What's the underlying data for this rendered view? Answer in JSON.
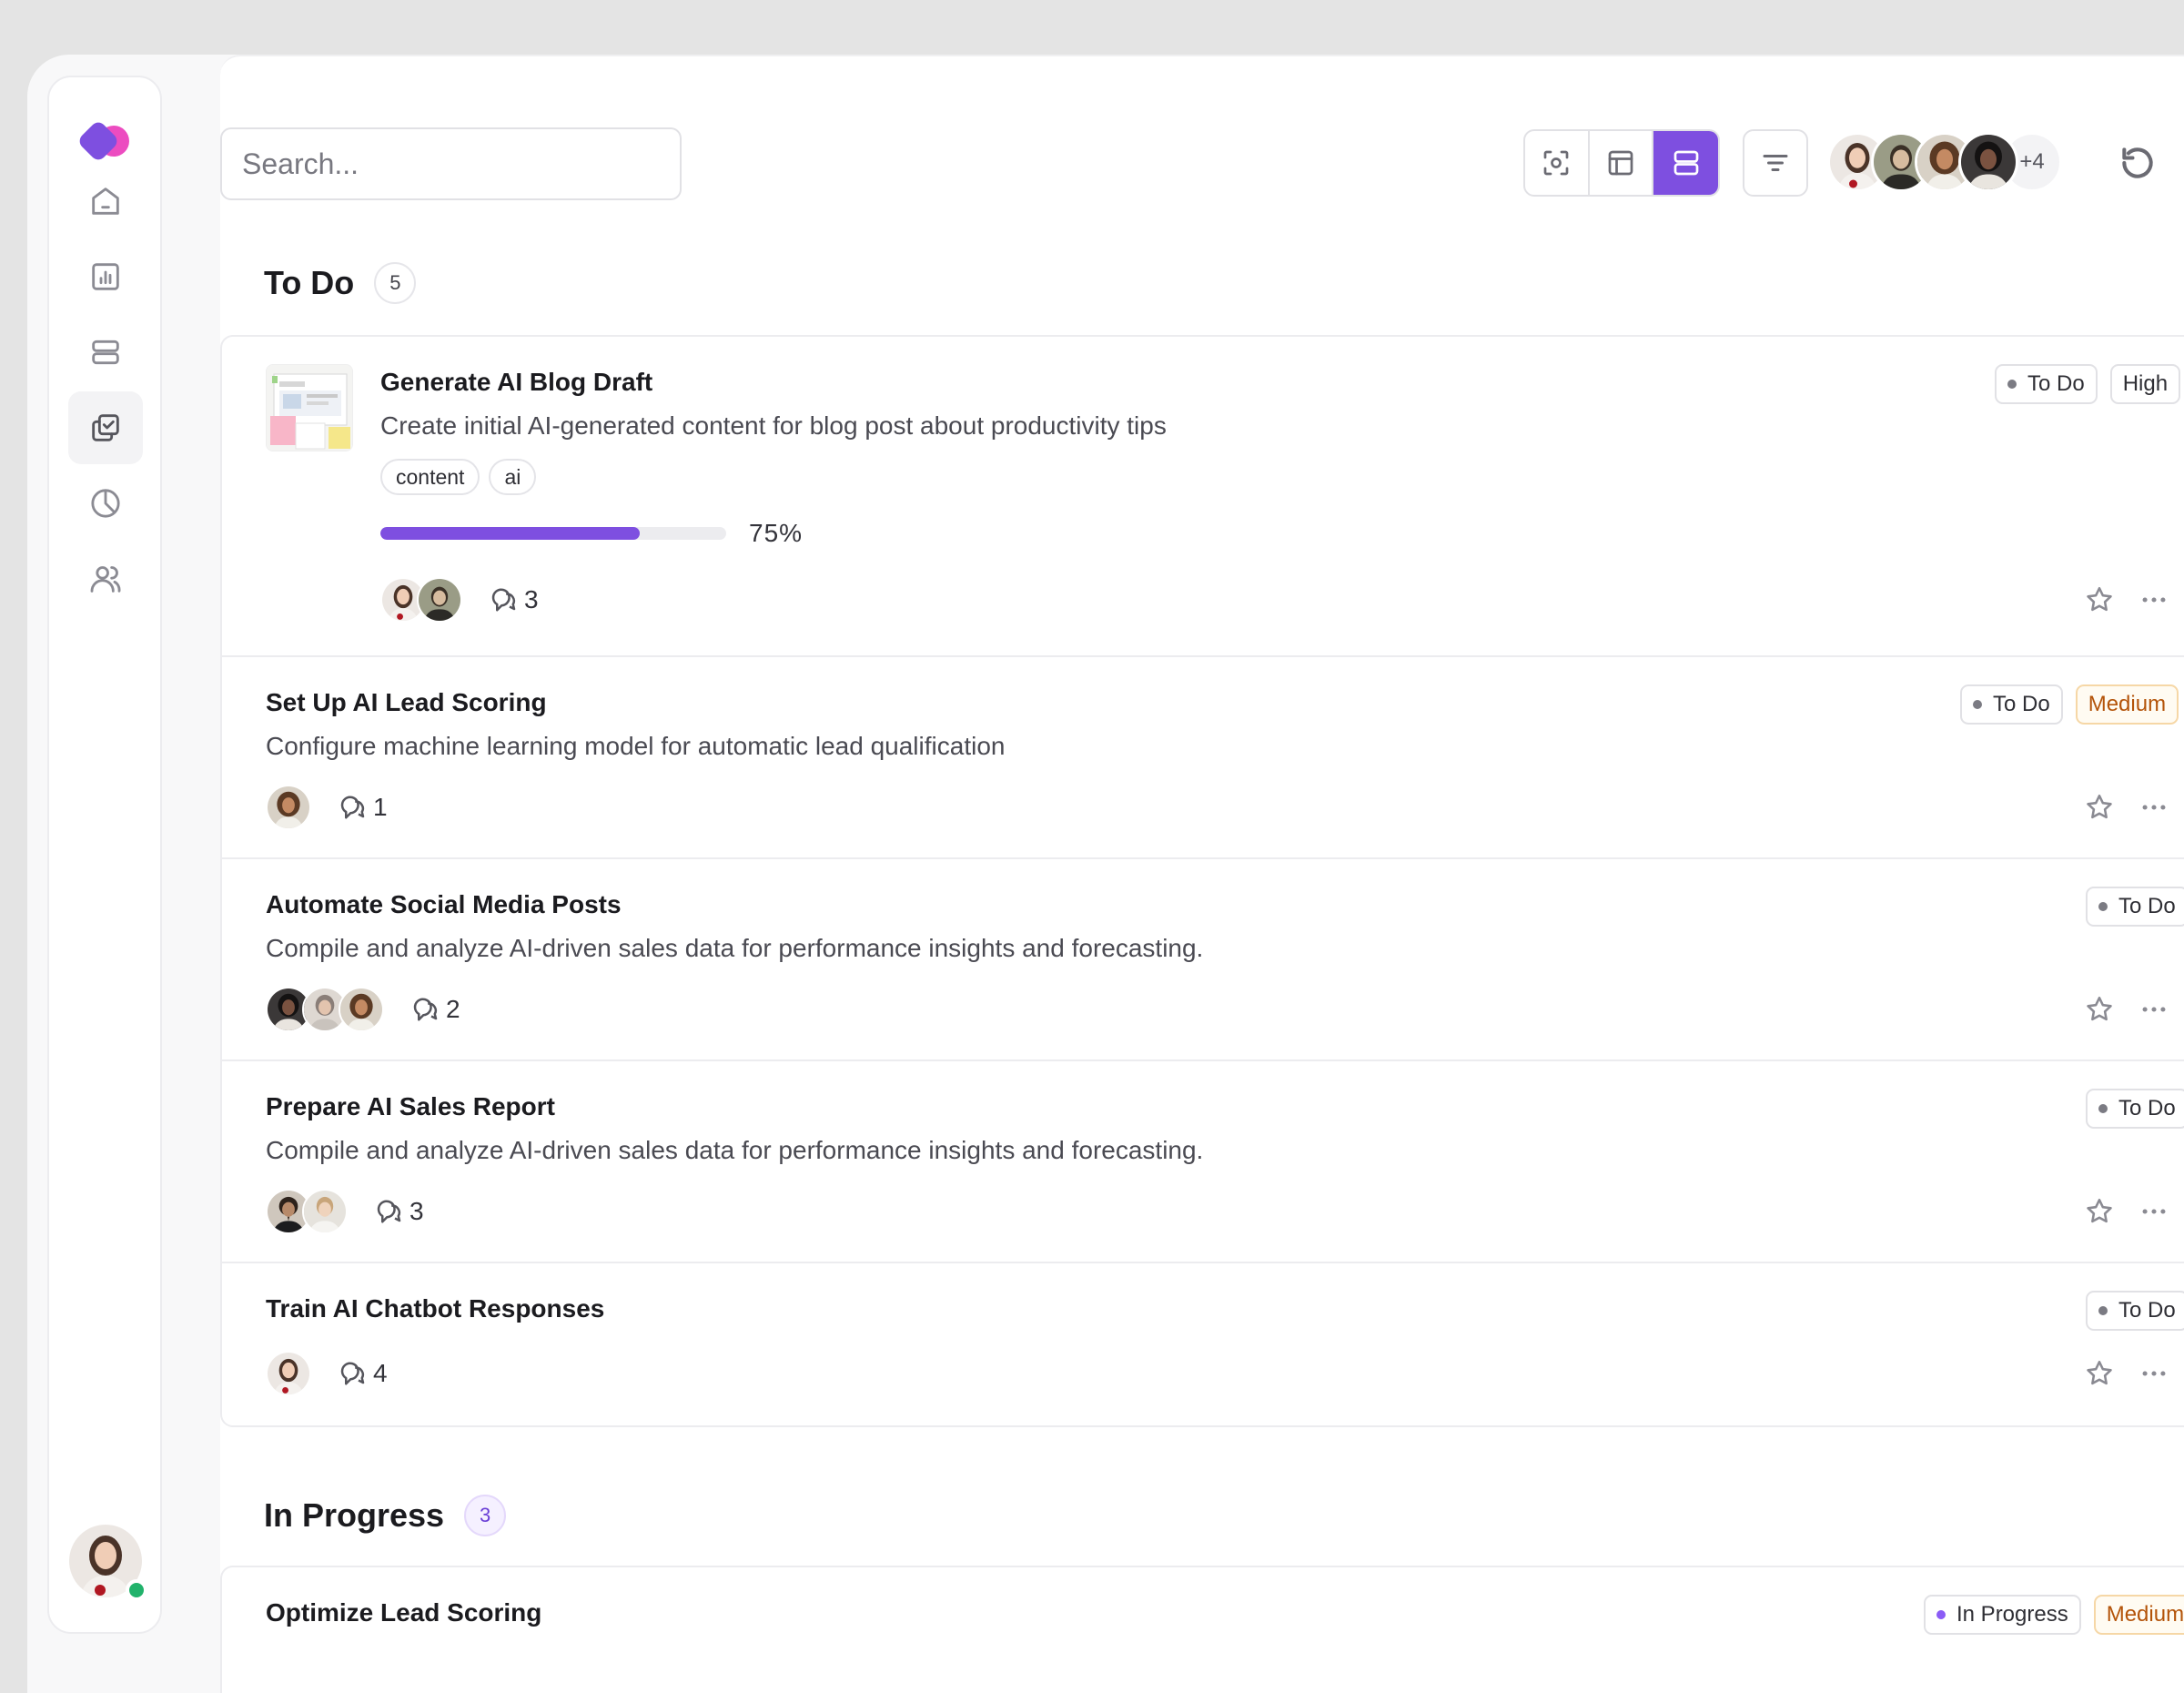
{
  "search": {
    "placeholder": "Search..."
  },
  "team": {
    "more_label": "+4"
  },
  "sections": {
    "todo": {
      "title": "To Do",
      "count": "5"
    },
    "in_progress": {
      "title": "In Progress",
      "count": "3"
    }
  },
  "tasks": [
    {
      "title": "Generate AI Blog Draft",
      "description": "Create initial AI-generated content for blog post about productivity tips",
      "tags": [
        "content",
        "ai"
      ],
      "progress_percent": 75,
      "progress_label": "75%",
      "comments": "3",
      "status": "To Do",
      "priority": "High"
    },
    {
      "title": "Set Up AI Lead Scoring",
      "description": "Configure machine learning model for automatic lead qualification",
      "comments": "1",
      "status": "To Do",
      "priority": "Medium"
    },
    {
      "title": "Automate Social Media Posts",
      "description": "Compile and analyze AI-driven sales data for performance insights and forecasting.",
      "comments": "2",
      "status": "To Do"
    },
    {
      "title": "Prepare AI Sales Report",
      "description": "Compile and analyze AI-driven sales data for performance insights and forecasting.",
      "comments": "3",
      "status": "To Do"
    },
    {
      "title": "Train AI Chatbot Responses",
      "comments": "4",
      "status": "To Do"
    },
    {
      "title": "Optimize Lead Scoring",
      "status": "In Progress",
      "priority": "Medium"
    }
  ],
  "colors": {
    "accent": "#7e4fe0",
    "online": "#21b26b",
    "medium": "#b4540a"
  },
  "icons": [
    "logo-icon",
    "home-icon",
    "chart-icon",
    "layers-icon",
    "tasks-icon",
    "pie-chart-icon",
    "users-icon",
    "scan-icon",
    "table-icon",
    "list-icon",
    "filter-icon",
    "refresh-icon",
    "comment-icon",
    "star-icon",
    "more-icon"
  ]
}
